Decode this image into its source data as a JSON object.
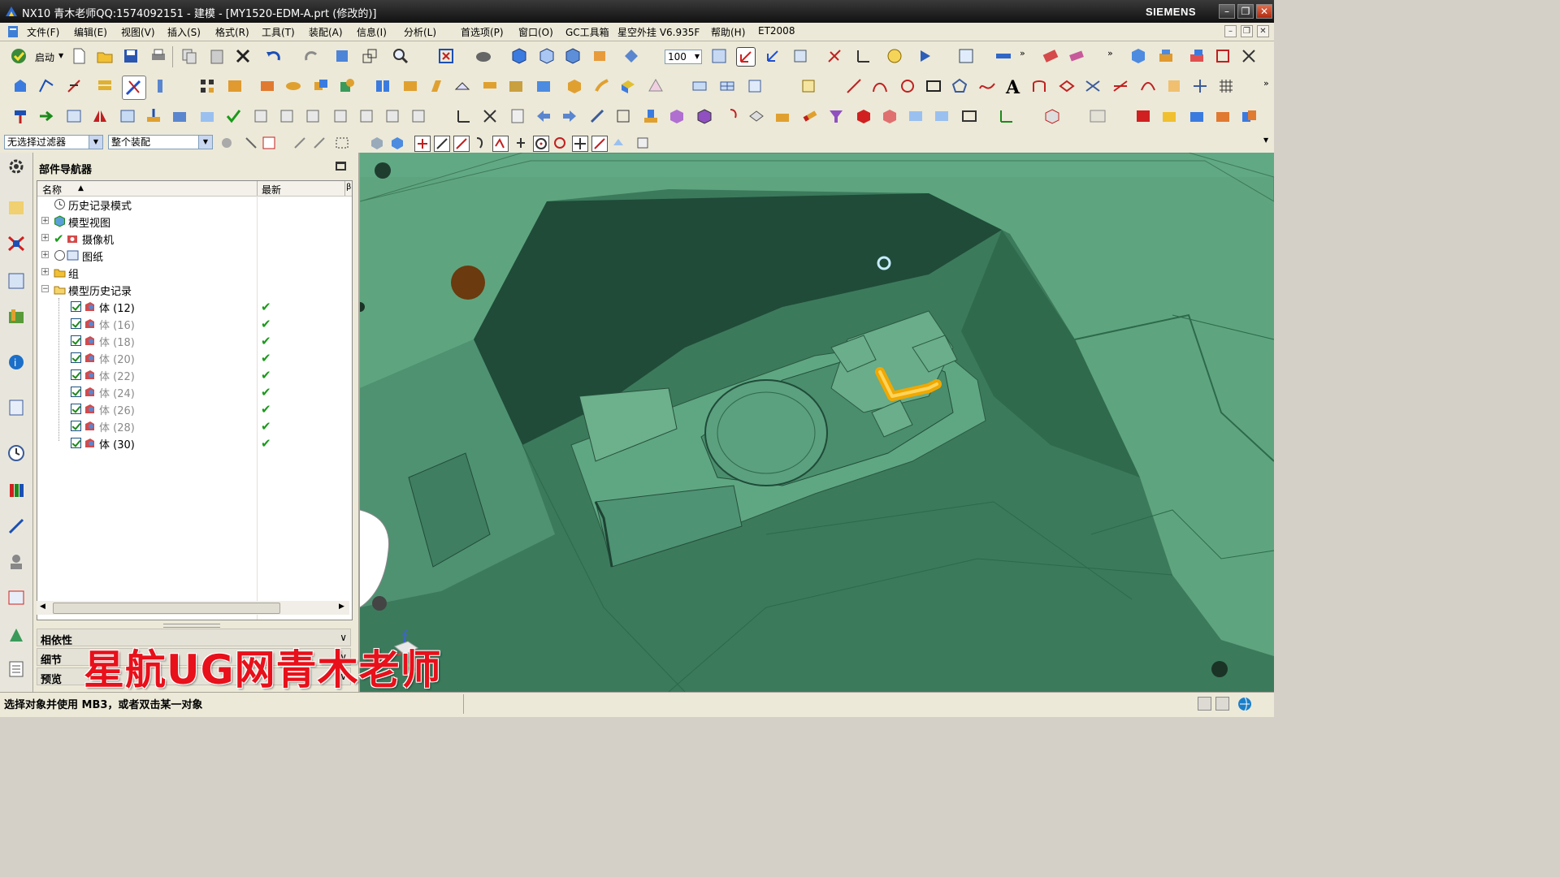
{
  "window": {
    "title": "NX10 青木老师QQ:1574092151 - 建模 - [MY1520-EDM-A.prt (修改的)]",
    "brand": "SIEMENS",
    "buttons": [
      "minimize-icon",
      "restore-icon",
      "close-icon"
    ]
  },
  "menubar": {
    "items": [
      "文件(F)",
      "编辑(E)",
      "视图(V)",
      "插入(S)",
      "格式(R)",
      "工具(T)",
      "装配(A)",
      "信息(I)",
      "分析(L)",
      "首选项(P)",
      "窗口(O)",
      "GC工具箱",
      "星空外挂 V6.935F",
      "帮助(H)",
      "ET2008"
    ]
  },
  "toolbar": {
    "start_label": "启动",
    "zoom_value": "100"
  },
  "filterbar": {
    "selection_filter": "无选择过滤器",
    "scope": "整个装配"
  },
  "navigator": {
    "title": "部件导航器",
    "columns": {
      "name": "名称",
      "latest": "最新",
      "extra": "β"
    },
    "top_nodes": [
      {
        "label": "历史记录模式",
        "icon": "clock-icon"
      },
      {
        "label": "模型视图",
        "icon": "model-views-icon"
      },
      {
        "label": "摄像机",
        "icon": "camera-icon"
      },
      {
        "label": "图纸",
        "icon": "drawing-icon"
      },
      {
        "label": "组",
        "icon": "folder-icon"
      },
      {
        "label": "模型历史记录",
        "icon": "folder-open-icon"
      }
    ],
    "bodies": [
      {
        "label": "体 (12)",
        "active": true,
        "latest": "✔"
      },
      {
        "label": "体 (16)",
        "active": false,
        "latest": "✔"
      },
      {
        "label": "体 (18)",
        "active": false,
        "latest": "✔"
      },
      {
        "label": "体 (20)",
        "active": false,
        "latest": "✔"
      },
      {
        "label": "体 (22)",
        "active": false,
        "latest": "✔"
      },
      {
        "label": "体 (24)",
        "active": false,
        "latest": "✔"
      },
      {
        "label": "体 (26)",
        "active": false,
        "latest": "✔"
      },
      {
        "label": "体 (28)",
        "active": false,
        "latest": "✔"
      },
      {
        "label": "体 (30)",
        "active": true,
        "latest": "✔"
      }
    ],
    "sections": [
      "相依性",
      "细节",
      "预览"
    ]
  },
  "watermark": "星航UG网青木老师",
  "status": {
    "message": "选择对象并使用 MB3，或者双击某一对象"
  },
  "colors": {
    "model_green": "#5ea57f",
    "highlight_orange": "#f0a800",
    "title_bar": "#1a1a1a",
    "watermark_red": "#e8101a"
  }
}
